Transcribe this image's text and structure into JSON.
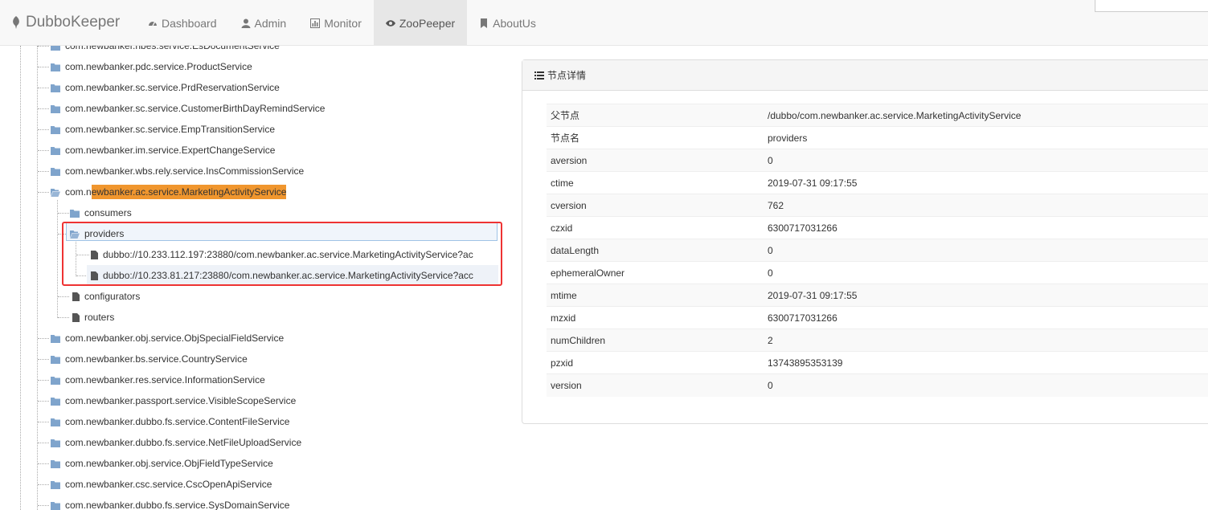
{
  "brand": {
    "name": "DubboKeeper"
  },
  "nav": [
    {
      "label": "Dashboard",
      "icon": "dashboard-icon"
    },
    {
      "label": "Admin",
      "icon": "user-icon"
    },
    {
      "label": "Monitor",
      "icon": "bar-chart-icon"
    },
    {
      "label": "ZooPeeper",
      "icon": "eye-icon",
      "active": true
    },
    {
      "label": "AboutUs",
      "icon": "bookmark-icon"
    }
  ],
  "tree": {
    "items": [
      "com.newbanker.nbes.service.EsDocumentService",
      "com.newbanker.pdc.service.ProductService",
      "com.newbanker.sc.service.PrdReservationService",
      "com.newbanker.sc.service.CustomerBirthDayRemindService",
      "com.newbanker.sc.service.EmpTransitionService",
      "com.newbanker.im.service.ExpertChangeService",
      "com.newbanker.wbs.rely.service.InsCommissionService"
    ],
    "open_node": {
      "prefix": "com.n",
      "highlighted": "ewbanker.ac.service.MarketingActivityService",
      "children": {
        "consumers": "consumers",
        "providers": "providers",
        "providers_children": [
          "dubbo://10.233.112.197:23880/com.newbanker.ac.service.MarketingActivityService?ac",
          "dubbo://10.233.81.217:23880/com.newbanker.ac.service.MarketingActivityService?acc"
        ],
        "configurators": "configurators",
        "routers": "routers"
      }
    },
    "items_after": [
      "com.newbanker.obj.service.ObjSpecialFieldService",
      "com.newbanker.bs.service.CountryService",
      "com.newbanker.res.service.InformationService",
      "com.newbanker.passport.service.VisibleScopeService",
      "com.newbanker.dubbo.fs.service.ContentFileService",
      "com.newbanker.dubbo.fs.service.NetFileUploadService",
      "com.newbanker.obj.service.ObjFieldTypeService",
      "com.newbanker.csc.service.CscOpenApiService",
      "com.newbanker.dubbo.fs.service.SysDomainService"
    ]
  },
  "panel": {
    "title": "节点详情",
    "rows": [
      {
        "key": "父节点",
        "value": "/dubbo/com.newbanker.ac.service.MarketingActivityService"
      },
      {
        "key": "节点名",
        "value": "providers"
      },
      {
        "key": "aversion",
        "value": "0"
      },
      {
        "key": "ctime",
        "value": "2019-07-31 09:17:55"
      },
      {
        "key": "cversion",
        "value": "762"
      },
      {
        "key": "czxid",
        "value": "6300717031266"
      },
      {
        "key": "dataLength",
        "value": "0"
      },
      {
        "key": "ephemeralOwner",
        "value": "0"
      },
      {
        "key": "mtime",
        "value": "2019-07-31 09:17:55"
      },
      {
        "key": "mzxid",
        "value": "6300717031266"
      },
      {
        "key": "numChildren",
        "value": "2"
      },
      {
        "key": "pzxid",
        "value": "13743895353139"
      },
      {
        "key": "version",
        "value": "0"
      }
    ]
  },
  "colors": {
    "highlight": "#f0962e",
    "folder": "#7fa4cc",
    "annotation": "#e33333"
  }
}
